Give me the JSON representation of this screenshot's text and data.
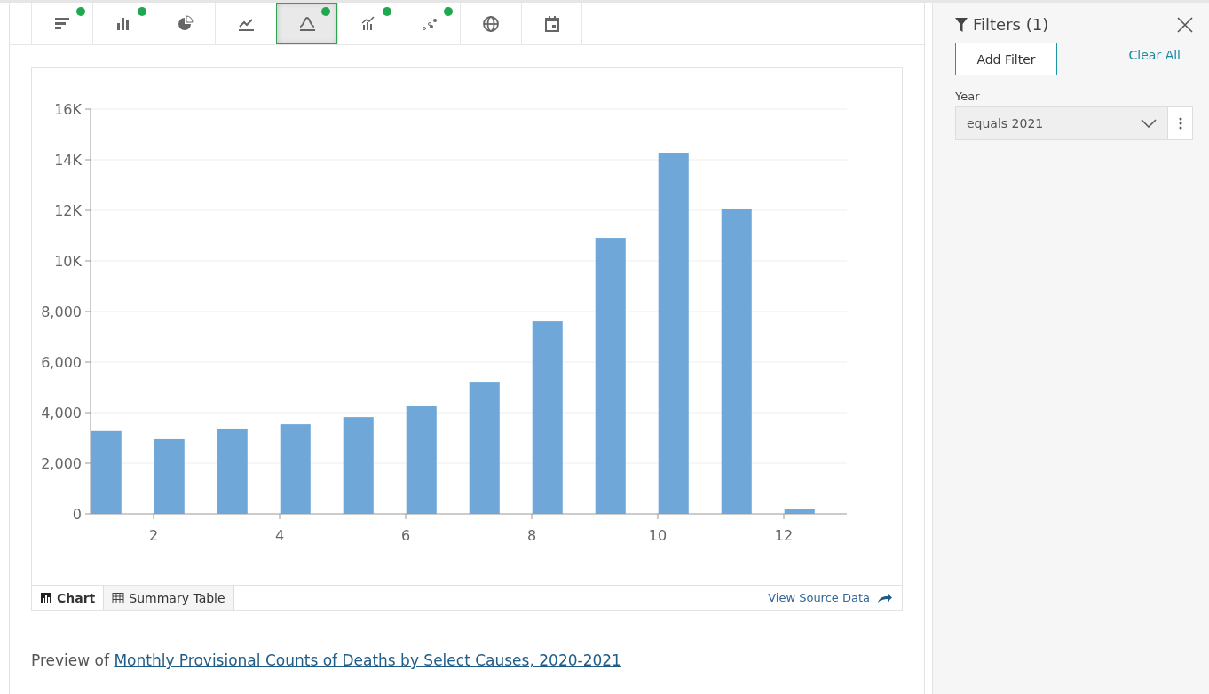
{
  "toolbar": [
    {
      "kind": "hbar",
      "dot": true,
      "selected": false
    },
    {
      "kind": "bar",
      "dot": true,
      "selected": false
    },
    {
      "kind": "pie",
      "dot": false,
      "selected": false
    },
    {
      "kind": "line",
      "dot": false,
      "selected": false
    },
    {
      "kind": "curve",
      "dot": true,
      "selected": true
    },
    {
      "kind": "combo",
      "dot": true,
      "selected": false
    },
    {
      "kind": "scatter",
      "dot": true,
      "selected": false
    },
    {
      "kind": "globe",
      "dot": false,
      "selected": false
    },
    {
      "kind": "calendar",
      "dot": false,
      "selected": false
    }
  ],
  "chart": {
    "chart_data": {
      "type": "bar",
      "x": [
        1.25,
        2.25,
        3.25,
        4.25,
        5.25,
        6.25,
        7.25,
        8.25,
        9.25,
        10.25,
        11.25,
        12.25
      ],
      "grid": true,
      "series": [
        {
          "color": "#6fa8d8",
          "values": [
            3270,
            2950,
            3370,
            3540,
            3820,
            4280,
            5190,
            7610,
            10910,
            14280,
            12070,
            210
          ]
        }
      ],
      "xlim": [
        1,
        13
      ],
      "ylim": [
        0,
        16000
      ],
      "xticks": [
        2,
        4,
        6,
        8,
        10,
        12
      ],
      "yticks": [
        {
          "value": 0,
          "label": "0"
        },
        {
          "value": 2000,
          "label": "2,000"
        },
        {
          "value": 4000,
          "label": "4,000"
        },
        {
          "value": 6000,
          "label": "6,000"
        },
        {
          "value": 8000,
          "label": "8,000"
        },
        {
          "value": 10000,
          "label": "10K"
        },
        {
          "value": 12000,
          "label": "12K"
        },
        {
          "value": 14000,
          "label": "14K"
        },
        {
          "value": 16000,
          "label": "16K"
        }
      ]
    },
    "tabs": [
      {
        "kind": "chart",
        "label": "Chart",
        "selected": true
      },
      {
        "kind": "table",
        "label": "Summary Table",
        "selected": false
      }
    ],
    "source_link": "View Source Data"
  },
  "preview": {
    "prefix": "Preview of",
    "link": "Monthly Provisional Counts of Deaths by Select Causes, 2020-2021"
  },
  "filters": {
    "title": "Filters (1)",
    "add_button": "Add Filter",
    "clear_link": "Clear All",
    "items": [
      {
        "label": "Year",
        "value": "equals 2021"
      }
    ]
  }
}
